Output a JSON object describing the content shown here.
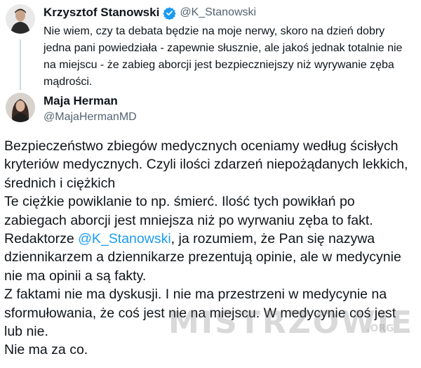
{
  "quoted_tweet": {
    "author_name": "Krzysztof Stanowski",
    "handle": "@K_Stanowski",
    "verified": true,
    "text": "Nie wiem, czy ta debata będzie na moje nerwy, skoro na dzień dobry jedna pani powiedziała - zapewnie słusznie, ale jakoś jednak totalnie nie na miejscu - że zabieg aborcji jest bezpieczniejszy niż wyrywanie zęba mądrości."
  },
  "reply_tweet": {
    "author_name": "Maja Herman",
    "handle": "@MajaHermanMD",
    "lines": [
      "Bezpieczeństwo zbiegów medycznych oceniamy według ścisłych",
      "kryteriów medycznych. Czyli ilości zdarzeń niepożądanych lekkich,",
      "średnich i ciężkich",
      "Te ciężkie powiklanie to np. śmierć. Ilość tych powikłań po",
      "zabiegach aborcji jest mniejsza niż po wyrwaniu zęba to fakt."
    ],
    "line6_prefix": "Redaktorze ",
    "mention": "@K_Stanowski",
    "line6_suffix": ", ja rozumiem, że Pan się nazywa",
    "lines_after": [
      "dziennikarzem a dziennikarze prezentują opinie, ale w medycynie",
      "nie ma opinii a są fakty.",
      "Z faktami nie ma dyskusji. I nie ma  przestrzeni w medycynie na",
      "sformułowania, że coś jest nie na miejscu. W medycynie coś jest",
      "lub nie.",
      "Nie ma za co."
    ]
  },
  "watermark": {
    "text": "MISTRZOWIE",
    "tld": ".ORG"
  },
  "colors": {
    "text": "#0f1419",
    "secondary": "#536471",
    "link": "#1d9bf0",
    "verified": "#1d9bf0"
  }
}
